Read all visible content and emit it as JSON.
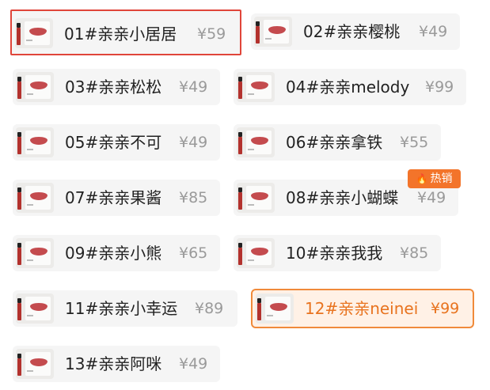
{
  "items": [
    {
      "label": "01#亲亲小居居",
      "price": "¥59",
      "state": "outlined"
    },
    {
      "label": "02#亲亲樱桃",
      "price": "¥49",
      "state": "normal"
    },
    {
      "label": "03#亲亲松松",
      "price": "¥49",
      "state": "normal"
    },
    {
      "label": "04#亲亲melody",
      "price": "¥99",
      "state": "normal"
    },
    {
      "label": "05#亲亲不可",
      "price": "¥49",
      "state": "normal"
    },
    {
      "label": "06#亲亲拿铁",
      "price": "¥55",
      "state": "normal"
    },
    {
      "label": "07#亲亲果酱",
      "price": "¥85",
      "state": "normal"
    },
    {
      "label": "08#亲亲小蝴蝶",
      "price": "¥49",
      "state": "normal",
      "badge": "热销"
    },
    {
      "label": "09#亲亲小熊",
      "price": "¥65",
      "state": "normal"
    },
    {
      "label": "10#亲亲我我",
      "price": "¥85",
      "state": "normal"
    },
    {
      "label": "11#亲亲小幸运",
      "price": "¥89",
      "state": "normal"
    },
    {
      "label": "12#亲亲neinei",
      "price": "¥99",
      "state": "selected"
    },
    {
      "label": "13#亲亲阿咪",
      "price": "¥49",
      "state": "normal"
    }
  ],
  "hot_badge": {
    "text": "热销",
    "icon": "flame-icon"
  },
  "colors": {
    "accent": "#f08a3a",
    "outline": "#e0453a",
    "chip_bg": "#f5f5f5",
    "price": "#9a9a9a"
  }
}
